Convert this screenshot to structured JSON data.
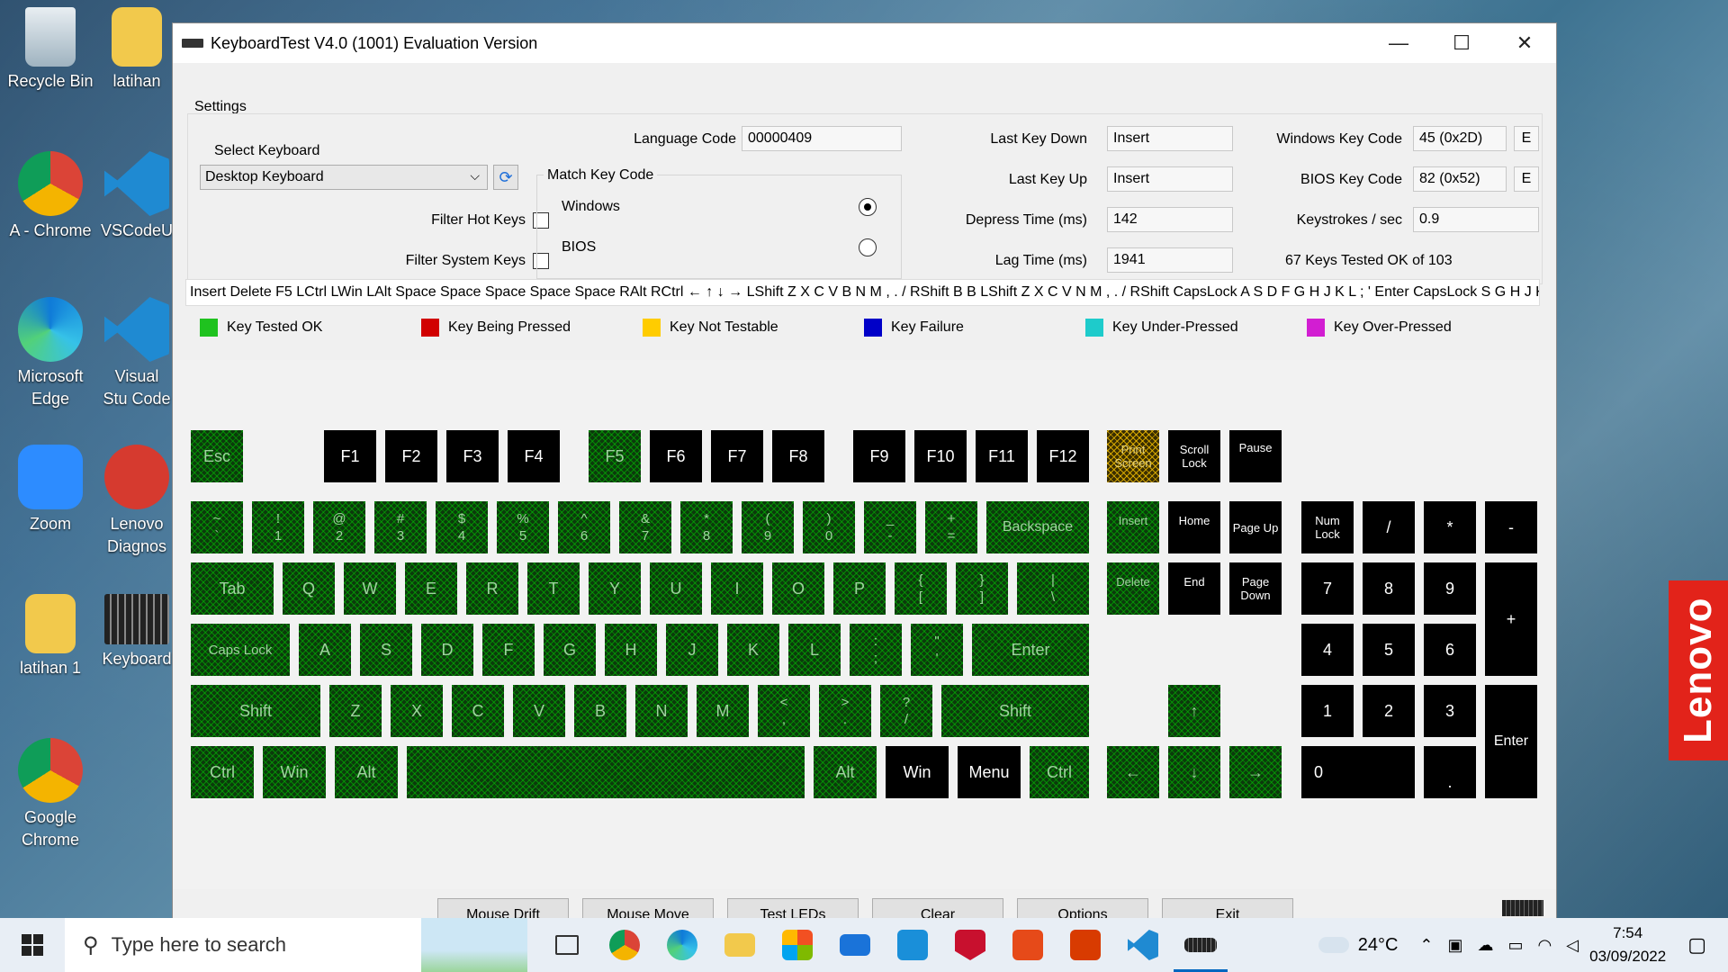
{
  "desktop": {
    "icons": [
      {
        "label": "Recycle Bin"
      },
      {
        "label": "latihan"
      },
      {
        "label": "A - Chrome"
      },
      {
        "label": "VSCodeU"
      },
      {
        "label": "Microsoft Edge"
      },
      {
        "label": "Visual Stu Code"
      },
      {
        "label": "Zoom"
      },
      {
        "label": "Lenovo Diagnos"
      },
      {
        "label": "latihan 1"
      },
      {
        "label": "Keyboard"
      },
      {
        "label": "Google Chrome"
      }
    ],
    "brand": "Lenovo"
  },
  "window": {
    "title": "KeyboardTest V4.0 (1001) Evaluation Version",
    "minimize": "—",
    "maximize": "☐",
    "close": "✕"
  },
  "settings": {
    "heading": "Settings",
    "select_keyboard_label": "Select Keyboard",
    "keyboard_value": "Desktop Keyboard",
    "filter_hot_keys": "Filter Hot Keys",
    "filter_system_keys": "Filter System Keys",
    "language_code_label": "Language Code",
    "language_code_value": "00000409",
    "match_key_code": "Match Key Code",
    "windows": "Windows",
    "bios": "BIOS",
    "last_key_down_label": "Last Key Down",
    "last_key_down_value": "Insert",
    "last_key_up_label": "Last Key Up",
    "last_key_up_value": "Insert",
    "depress_time_label": "Depress Time (ms)",
    "depress_time_value": "142",
    "lag_time_label": "Lag Time (ms)",
    "lag_time_value": "1941",
    "windows_key_code_label": "Windows Key Code",
    "windows_key_code_value": "45 (0x2D)",
    "bios_key_code_label": "BIOS Key Code",
    "bios_key_code_value": "82 (0x52)",
    "e_label": "E",
    "keystrokes_label": "Keystrokes / sec",
    "keystrokes_value": "0.9",
    "tested_summary": "67 Keys Tested OK of 103"
  },
  "history": "Insert Delete F5 LCtrl LWin LAlt Space Space Space Space Space RAlt RCtrl ← ↑ ↓ → LShift Z X C V B N M , . / RShift B B LShift Z X C V N M , . / RShift CapsLock A S D F G H J K L ; ' Enter CapsLock S G H J K L ; '",
  "legend": [
    {
      "label": "Key Tested OK",
      "color": "#1fc21f"
    },
    {
      "label": "Key Being Pressed",
      "color": "#d10000"
    },
    {
      "label": "Key Not Testable",
      "color": "#ffcc00"
    },
    {
      "label": "Key Failure",
      "color": "#0000c8"
    },
    {
      "label": "Key Under-Pressed",
      "color": "#1ecbcb"
    },
    {
      "label": "Key Over-Pressed",
      "color": "#d21ed2"
    }
  ],
  "keys": {
    "esc": "Esc",
    "f1": "F1",
    "f2": "F2",
    "f3": "F3",
    "f4": "F4",
    "f5": "F5",
    "f6": "F6",
    "f7": "F7",
    "f8": "F8",
    "f9": "F9",
    "f10": "F10",
    "f11": "F11",
    "f12": "F12",
    "printscreen": "Print Screen",
    "scrolllock": "Scroll Lock",
    "pause": "Pause",
    "tilde": "~",
    "backtick": "`",
    "n1s": "!",
    "n1": "1",
    "n2s": "@",
    "n2": "2",
    "n3s": "#",
    "n3": "3",
    "n4s": "$",
    "n4": "4",
    "n5s": "%",
    "n5": "5",
    "n6s": "^",
    "n6": "6",
    "n7s": "&",
    "n7": "7",
    "n8s": "*",
    "n8": "8",
    "n9s": "(",
    "n9": "9",
    "n0s": ")",
    "n0": "0",
    "minus_s": "_",
    "minus": "-",
    "plus_s": "+",
    "equal": "=",
    "backspace": "Backspace",
    "insert": "Insert",
    "home": "Home",
    "pageup": "Page Up",
    "numlock": "Num Lock",
    "kp_div": "/",
    "kp_mul": "*",
    "kp_minus": "-",
    "tab": "Tab",
    "q": "Q",
    "w": "W",
    "e": "E",
    "r": "R",
    "t": "T",
    "y": "Y",
    "u": "U",
    "i": "I",
    "o": "O",
    "p": "P",
    "lbrace": "{",
    "lbracket": "[",
    "rbrace": "}",
    "rbracket": "]",
    "pipe": "|",
    "backslash": "\\",
    "delete": "Delete",
    "end": "End",
    "pagedown": "Page Down",
    "kp7": "7",
    "kp8": "8",
    "kp9": "9",
    "kp_plus": "+",
    "capslock": "Caps Lock",
    "a": "A",
    "s": "S",
    "d": "D",
    "f": "F",
    "g": "G",
    "h": "H",
    "j": "J",
    "k": "K",
    "l": "L",
    "colon": ":",
    "semicolon": ";",
    "dquote": "\"",
    "squote": "'",
    "enter": "Enter",
    "kp4": "4",
    "kp5": "5",
    "kp6": "6",
    "lshift": "Shift",
    "z": "Z",
    "x": "X",
    "c": "C",
    "v": "V",
    "b": "B",
    "n": "N",
    "m": "M",
    "lt": "<",
    "comma": ",",
    "gt": ">",
    "period": ".",
    "qmark": "?",
    "slash": "/",
    "rshift": "Shift",
    "up": "↑",
    "kp1": "1",
    "kp2": "2",
    "kp3": "3",
    "kp_enter": "Enter",
    "lctrl": "Ctrl",
    "lwin": "Win",
    "lalt": "Alt",
    "ralt": "Alt",
    "rwin": "Win",
    "menu": "Menu",
    "rctrl": "Ctrl",
    "left": "←",
    "down": "↓",
    "right": "→",
    "kp0": "0",
    "kp_dot": "."
  },
  "buttons": {
    "mouse_drift": "Mouse Drift",
    "mouse_move": "Mouse Move",
    "test_leds": "Test LEDs",
    "clear": "Clear",
    "options": "Options",
    "exit": "Exit"
  },
  "taskbar": {
    "search_placeholder": "Type here to search",
    "weather": "24°C",
    "time": "7:54",
    "date": "03/09/2022"
  }
}
